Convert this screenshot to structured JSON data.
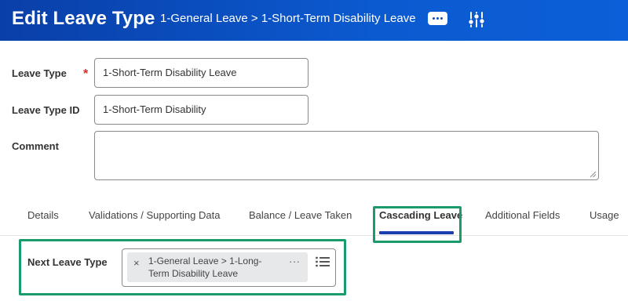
{
  "header": {
    "title": "Edit Leave Type",
    "breadcrumb": "1-General Leave > 1-Short-Term Disability Leave",
    "background_color": "#0b52c6",
    "more_icon": "ellipsis-icon",
    "settings_icon": "sliders-icon"
  },
  "form": {
    "leave_type": {
      "label": "Leave Type",
      "required_mark": "*",
      "value": "1-Short-Term Disability Leave"
    },
    "leave_type_id": {
      "label": "Leave Type ID",
      "value": "1-Short-Term Disability"
    },
    "comment": {
      "label": "Comment",
      "value": ""
    }
  },
  "tabs": [
    {
      "label": "Details",
      "active": false
    },
    {
      "label": "Validations / Supporting Data",
      "active": false
    },
    {
      "label": "Balance / Leave Taken",
      "active": false
    },
    {
      "label": "Cascading Leave",
      "active": true
    },
    {
      "label": "Additional Fields",
      "active": false
    },
    {
      "label": "Usage",
      "active": false
    }
  ],
  "cascading": {
    "next_leave_type_label": "Next Leave Type",
    "selected_item": {
      "remove_glyph": "×",
      "line1": "1-General Leave > 1-Long-",
      "line2": "Term Disability Leave",
      "more_glyph": "···"
    },
    "list_icon": "list-icon"
  },
  "colors": {
    "accent": "#1b3fae",
    "highlight": "#1a9b6b",
    "required": "#de2a2a"
  }
}
